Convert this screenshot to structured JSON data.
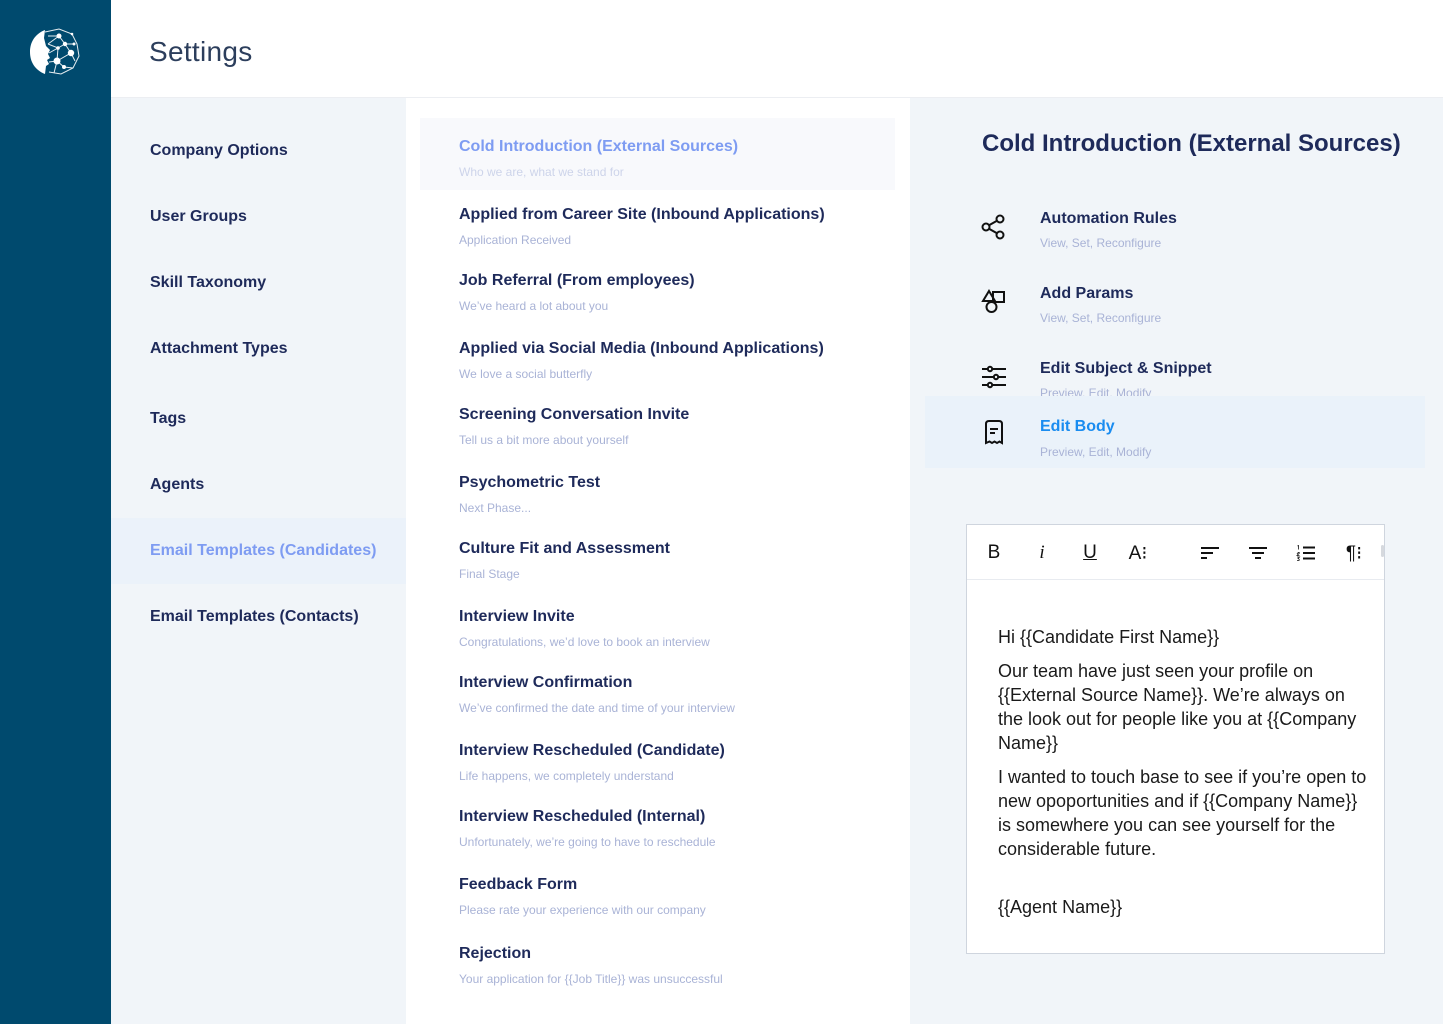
{
  "header": {
    "title": "Settings"
  },
  "brand": {
    "logo_icon": "face-network-logo",
    "rail_color": "#004a6e"
  },
  "nav": {
    "items": [
      {
        "label": "Company Options",
        "active": false
      },
      {
        "label": "User Groups",
        "active": false
      },
      {
        "label": "Skill Taxonomy",
        "active": false
      },
      {
        "label": "Attachment Types",
        "active": false
      },
      {
        "label": "Tags",
        "active": false
      },
      {
        "label": "Agents",
        "active": false
      },
      {
        "label": "Email Templates (Candidates)",
        "active": true
      },
      {
        "label": "Email Templates (Contacts)",
        "active": false
      }
    ]
  },
  "templates": {
    "items": [
      {
        "title": "Cold Introduction  (External Sources)",
        "subtitle": "Who we are, what we stand for",
        "active": true
      },
      {
        "title": "Applied from Career Site  (Inbound Applications)",
        "subtitle": "Application Received"
      },
      {
        "title": "Job Referral  (From employees)",
        "subtitle": "We’ve heard a lot about you"
      },
      {
        "title": "Applied via Social Media  (Inbound Applications)",
        "subtitle": "We love a social butterfly"
      },
      {
        "title": "Screening Conversation Invite",
        "subtitle": "Tell us a bit more about yourself"
      },
      {
        "title": "Psychometric Test",
        "subtitle": "Next Phase..."
      },
      {
        "title": "Culture Fit and Assessment",
        "subtitle": "Final Stage"
      },
      {
        "title": "Interview Invite",
        "subtitle": "Congratulations, we’d love to book an interview"
      },
      {
        "title": "Interview Confirmation",
        "subtitle": "We’ve confirmed the date and time of your interview"
      },
      {
        "title": "Interview Rescheduled (Candidate)",
        "subtitle": "Life happens, we completely understand"
      },
      {
        "title": "Interview Rescheduled (Internal)",
        "subtitle": "Unfortunately, we’re going to have to reschedule"
      },
      {
        "title": "Feedback Form",
        "subtitle": "Please rate your experience with our company"
      },
      {
        "title": "Rejection",
        "subtitle": "Your application for {{Job Title}} was unsuccessful"
      }
    ]
  },
  "detail": {
    "title": "Cold Introduction (External Sources)",
    "options": [
      {
        "title": "Automation Rules",
        "subtitle": "View, Set, Reconfigure",
        "icon": "share-nodes-icon"
      },
      {
        "title": "Add Params",
        "subtitle": "View, Set, Reconfigure",
        "icon": "shapes-icon"
      },
      {
        "title": "Edit Subject & Snippet",
        "subtitle": "Preview, Edit, Modify",
        "icon": "sliders-icon"
      },
      {
        "title": "Edit Body",
        "subtitle": "Preview, Edit, Modify",
        "icon": "receipt-document-icon",
        "active": true
      }
    ]
  },
  "editor": {
    "toolbar": {
      "bold": "B",
      "italic": "i",
      "underline": "U",
      "font_size": "A⁝",
      "paragraph": "¶⁝"
    },
    "body": {
      "greeting": "Hi {{Candidate First Name}}",
      "para1": "Our team have just seen your profile on {{External Source Name}}. We’re always on the look out for people like you at {{Company Name}}",
      "para2": "I wanted to touch base to see if you’re open to new opoportunities and if {{Company Name}} is somewhere you can see yourself for the considerable future.",
      "signature": "{{Agent Name}}"
    }
  },
  "colors": {
    "accent": "#7e9cf2",
    "active_link": "#1a8cf0",
    "text_primary": "#1e2a5a",
    "text_muted": "#a9b3d6",
    "panel_bg": "#f1f5f9"
  }
}
